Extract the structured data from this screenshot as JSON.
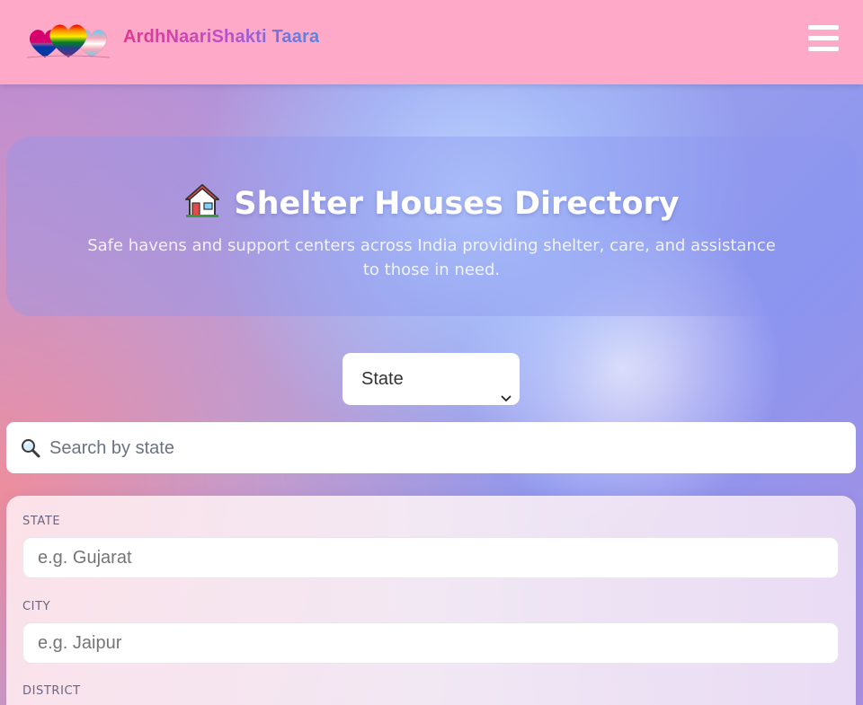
{
  "header": {
    "brand": "ArdhNaariShakti Taara",
    "logo_icon": "rainbow-hearts-logo",
    "menu_icon": "hamburger-menu-icon"
  },
  "hero": {
    "icon": "house-icon",
    "title": "Shelter Houses Directory",
    "subtitle": "Safe havens and support centers across India providing shelter, care, and assistance to those in need."
  },
  "filter": {
    "select_value": "State",
    "chevron_icon": "chevron-down-icon"
  },
  "search": {
    "icon": "magnifier-icon",
    "placeholder": "Search by state"
  },
  "form": {
    "fields": [
      {
        "label": "STATE",
        "placeholder": "e.g. Gujarat"
      },
      {
        "label": "CITY",
        "placeholder": "e.g. Jaipur"
      },
      {
        "label": "DISTRICT",
        "placeholder": ""
      }
    ]
  },
  "colors": {
    "header_bg": "#ffa9c9",
    "brand_gradient_start": "#e1368f",
    "brand_gradient_end": "#4a8ae6",
    "page_gradient_start": "#b487d8",
    "page_gradient_end": "#8c95ef"
  }
}
